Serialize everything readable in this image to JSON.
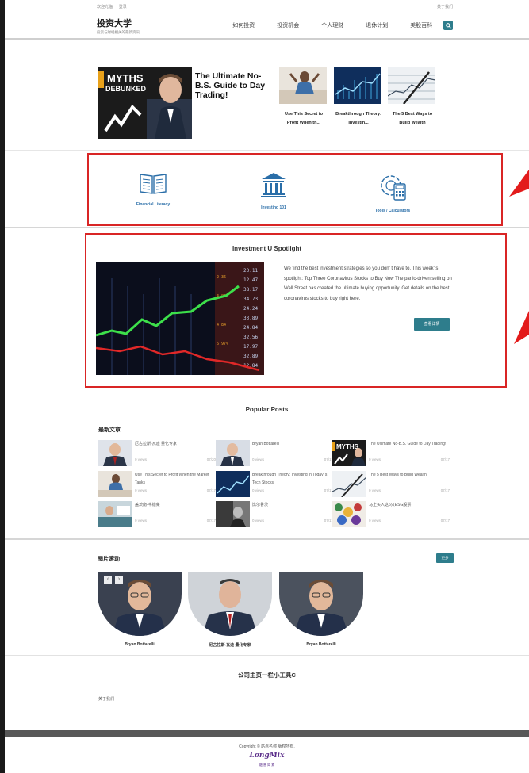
{
  "topbar": {
    "welcome": "欢迎光临!",
    "login": "登录",
    "about": "关于我们"
  },
  "header": {
    "site_title": "投资大学",
    "site_subtitle": "投资与财经相关的最新资讯"
  },
  "nav": [
    "如何投资",
    "投资机会",
    "个人理财",
    "退休计划",
    "美股百科"
  ],
  "featured": {
    "main_image_text": [
      "5",
      "MYTHS",
      "DEBUNKED"
    ],
    "main_title": "The Ultimate No-B.S. Guide to Day Trading!",
    "side": [
      {
        "caption": "Use This Secret to Profit When th..."
      },
      {
        "caption": "Breakthrough Theory: Investin..."
      },
      {
        "caption": "The 5 Best Ways to Build Wealth"
      }
    ]
  },
  "categories": [
    {
      "label": "Financial Literacy",
      "icon": "book-icon"
    },
    {
      "label": "Investing 101",
      "icon": "bank-icon"
    },
    {
      "label": "Tools / Calculators",
      "icon": "gear-calculator-icon"
    }
  ],
  "spotlight": {
    "title": "Investment U Spotlight",
    "text": "We find the best investment strategies so you don’ t have to. This week’ s spotlight: Top Three Coronavirus Stocks to Buy Now The panic-driven selling on Wall Street has created the ultimate buying opportunity. Get details on the best coronavirus stocks to buy right here.",
    "button": "查看详情"
  },
  "popular": {
    "title": "Popular Posts",
    "latest_heading": "最新文章",
    "posts": [
      {
        "title": "厄古拉斯-瓦迪 量化专家",
        "views": "0 views",
        "date": "07/20"
      },
      {
        "title": "Bryan Bottarelli",
        "views": "0 views",
        "date": "07/17"
      },
      {
        "title": "The Ultimate No-B.S. Guide to Day Trading!",
        "views": "0 views",
        "date": "07/17"
      },
      {
        "title": "Use This Secret to Profit When the Market Tanks",
        "views": "0 views",
        "date": "07/17"
      },
      {
        "title": "Breakthrough Theory: Investing in Today’ s Tech Stocks",
        "views": "0 views",
        "date": "07/17"
      },
      {
        "title": "The 5 Best Ways to Build Wealth",
        "views": "0 views",
        "date": "07/17"
      },
      {
        "title": "盖茨南-韦德莱",
        "views": "0 views",
        "date": "07/17"
      },
      {
        "title": "比尔鲁茨",
        "views": "0 views",
        "date": "07/17"
      },
      {
        "title": "马上买入这6只ESG股票",
        "views": "0 views",
        "date": "07/17"
      }
    ]
  },
  "gallery": {
    "heading": "图片滚动",
    "more": "更多",
    "items": [
      {
        "caption": "Bryan Bottarelli"
      },
      {
        "caption": "尼古拉斯-瓦迪 量化专家"
      },
      {
        "caption": "Bryan Bottarelli"
      }
    ]
  },
  "widget": {
    "heading": "公司主页一栏小工具C",
    "about": "关于我们"
  },
  "footer": {
    "copyright": "Copyright ©  站点名称  版权所有.",
    "logo": "LongMix",
    "logo_sub": "融 普 简 素"
  },
  "colors": {
    "accent": "#2e7d8c",
    "highlight_border": "#d92525",
    "link": "#2a6ea8"
  }
}
